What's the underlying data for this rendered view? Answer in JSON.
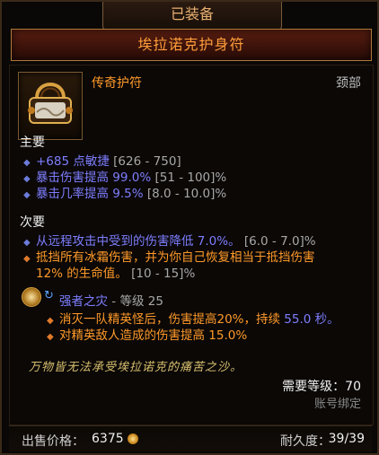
{
  "header": {
    "equipped_label": "已装备",
    "item_name": "埃拉诺克护身符"
  },
  "item": {
    "type": "传奇护符",
    "slot": "颈部"
  },
  "primary": {
    "label": "主要",
    "stats": [
      {
        "value": "+685 点敏捷",
        "range": " [626 - 750]"
      },
      {
        "value": "暴击伤害提高 99.0%",
        "range": " [51 - 100]%"
      },
      {
        "value": "暴击几率提高 9.5%",
        "range": " [8.0 - 10.0]%"
      }
    ]
  },
  "secondary": {
    "label": "次要",
    "stat1": {
      "value": "从远程攻击中受到的伤害降低 7.0%。",
      "range": " [6.0 - 7.0]%"
    },
    "stat2": {
      "line1": "抵挡所有冰霜伤害，并为你自己恢复相当于抵挡伤害",
      "line2_value": "12% 的生命值。",
      "line2_range": " [10 - 15]%"
    }
  },
  "legendary_gem": {
    "name": "强者之灾",
    "level": " - 等级 25",
    "effects": [
      {
        "text": "消灭一队精英怪后，伤害提高20%，持续 ",
        "highlight": "55.0 秒。"
      },
      {
        "text": "对精英敌人造成的伤害提高 15.0%",
        "highlight": ""
      }
    ]
  },
  "flavor_text": "万物皆无法承受埃拉诺克的痛苦之沙。",
  "requirements": {
    "level": "需要等级：70",
    "binding": "账号绑定"
  },
  "footer": {
    "sell_label": "出售价格：",
    "sell_value": "6375",
    "durability_label": "耐久度：",
    "durability_value": "39/39"
  },
  "icons": {
    "gold": "gold-coin-icon",
    "gem": "legendary-gem-icon",
    "item": "amulet-icon"
  }
}
